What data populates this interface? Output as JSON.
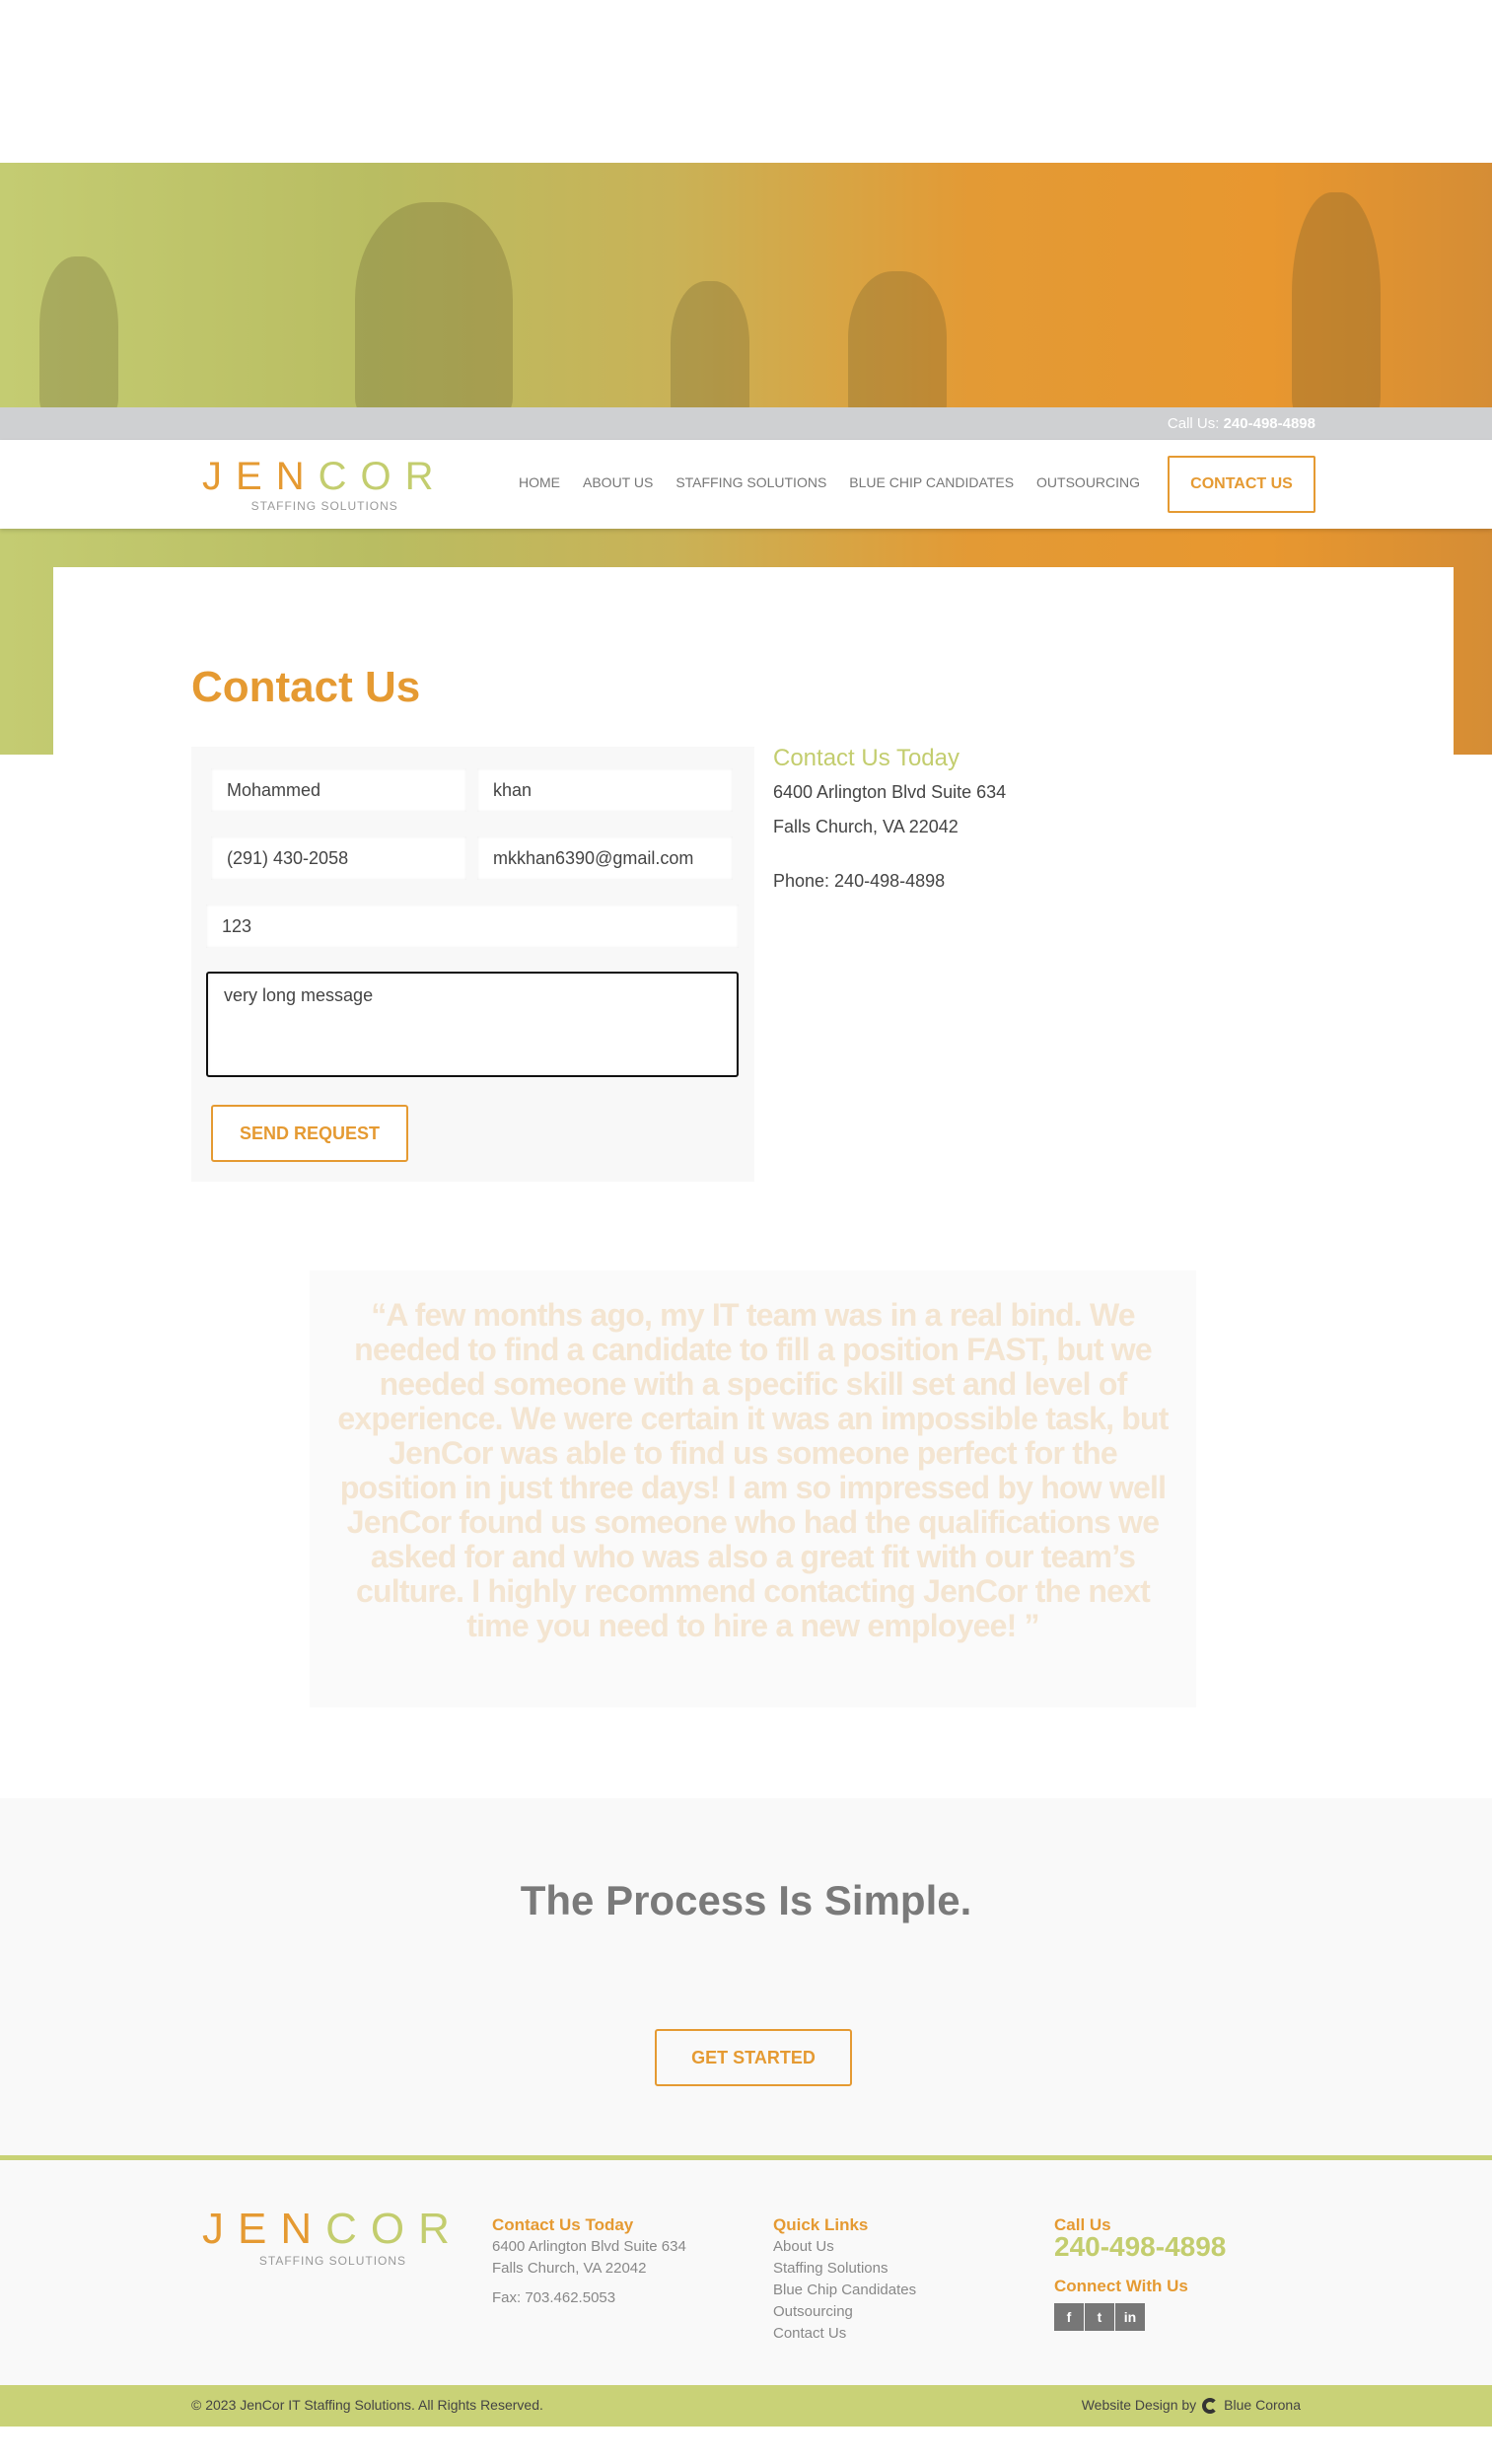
{
  "topbar": {
    "call_label": "Call Us:",
    "phone": "240-498-4898"
  },
  "logo": {
    "letters": [
      "J",
      "E",
      "N",
      "C",
      "O",
      "R"
    ],
    "tagline": "STAFFING SOLUTIONS"
  },
  "nav": {
    "items": [
      "HOME",
      "ABOUT US",
      "STAFFING SOLUTIONS",
      "BLUE CHIP CANDIDATES",
      "OUTSOURCING"
    ],
    "cta": "CONTACT US"
  },
  "page_title": "Contact Us",
  "form": {
    "first_name": "Mohammed",
    "last_name": "khan",
    "phone": "(291) 430-2058",
    "email": "mkkhan6390@gmail.com",
    "company": "123",
    "message": "very long message",
    "submit": "SEND REQUEST"
  },
  "info": {
    "title": "Contact Us Today",
    "address1": "6400 Arlington Blvd Suite 634",
    "address2": "Falls Church, VA 22042",
    "phone": "Phone: 240-498-4898"
  },
  "testimonial": "“A few months ago, my IT team was in a real bind. We needed to find a candidate to fill a position FAST, but we needed someone with a specific skill set and level of experience. We were certain it was an impossible task, but JenCor was able to find us someone perfect for the position in just three days! I am so impressed by how well JenCor found us someone who had the qualifications we asked for and who was also a great fit with our team’s culture. I highly recommend contacting JenCor the next time you need to hire a new employee! ”",
  "process": {
    "title": "The Process Is Simple.",
    "button": "GET STARTED"
  },
  "footer": {
    "contact_title": "Contact Us Today",
    "address1": "6400 Arlington Blvd Suite 634",
    "address2": "Falls Church, VA 22042",
    "fax": "Fax: 703.462.5053",
    "links_title": "Quick Links",
    "links": [
      "About Us",
      "Staffing Solutions",
      "Blue Chip Candidates",
      "Outsourcing",
      "Contact Us"
    ],
    "call_title": "Call Us",
    "phone": "240-498-4898",
    "connect_title": "Connect With Us",
    "social": [
      "f",
      "t",
      "in"
    ]
  },
  "bottom": {
    "copyright": "© 2023 JenCor IT Staffing Solutions. All Rights Reserved.",
    "design_by": "Website Design by",
    "designer": "Blue Corona"
  },
  "colors": {
    "orange": "#e59a32",
    "green": "#c3cd6e"
  }
}
